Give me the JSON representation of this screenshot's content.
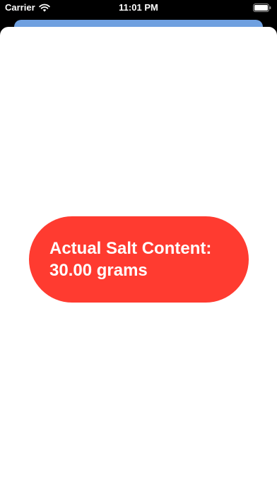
{
  "status_bar": {
    "carrier": "Carrier",
    "time": "11:01 PM",
    "icons": [
      "wifi-icon",
      "battery-icon"
    ]
  },
  "result": {
    "line1": "Actual Salt Content:",
    "line2": "30.00 grams"
  },
  "colors": {
    "result_background": "#ff3b30",
    "back_sheet": "#6fa0e0",
    "sheet_background": "#ffffff"
  }
}
